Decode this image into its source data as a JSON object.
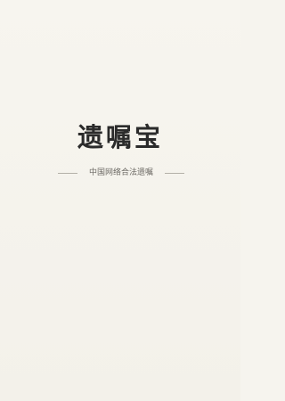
{
  "splash": {
    "app_name": "遗嘱宝",
    "tagline": "中国网络合法遗嘱"
  }
}
